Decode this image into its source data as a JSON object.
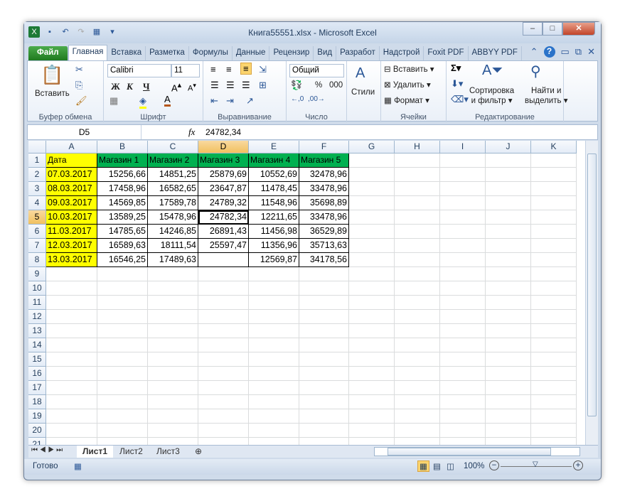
{
  "window": {
    "title": "Книга55551.xlsx - Microsoft Excel"
  },
  "tabs": [
    "Файл",
    "Главная",
    "Вставка",
    "Разметка",
    "Формулы",
    "Данные",
    "Рецензир",
    "Вид",
    "Разработ",
    "Надстрой",
    "Foxit PDF",
    "ABBYY PDF"
  ],
  "ribbon": {
    "clipboard": {
      "paste": "Вставить",
      "label": "Буфер обмена"
    },
    "font": {
      "name": "Calibri",
      "size": "11",
      "bold": "Ж",
      "italic": "К",
      "underline": "Ч",
      "label": "Шрифт"
    },
    "alignment": {
      "label": "Выравнивание"
    },
    "number": {
      "format": "Общий",
      "percent": "%",
      "thousands": "000",
      "label": "Число"
    },
    "styles": {
      "label": "Стили"
    },
    "cells": {
      "insert": "Вставить",
      "delete": "Удалить",
      "format": "Формат",
      "label": "Ячейки"
    },
    "editing": {
      "sort": "Сортировка",
      "sort2": "и фильтр",
      "find": "Найти и",
      "find2": "выделить",
      "label": "Редактирование"
    }
  },
  "formula_bar": {
    "name_box": "D5",
    "fx": "fx",
    "value": "24782,34"
  },
  "columns": [
    "A",
    "B",
    "C",
    "D",
    "E",
    "F",
    "G",
    "H",
    "I",
    "J",
    "K"
  ],
  "selected": {
    "col": "D",
    "row": 5
  },
  "rows": [
    [
      "Дата",
      "Магазин 1",
      "Магазин 2",
      "Магазин 3",
      "Магазин 4",
      "Магазин 5"
    ],
    [
      "07.03.2017",
      "15256,66",
      "14851,25",
      "25879,69",
      "10552,69",
      "32478,96"
    ],
    [
      "08.03.2017",
      "17458,96",
      "16582,65",
      "23647,87",
      "11478,45",
      "33478,96"
    ],
    [
      "09.03.2017",
      "14569,85",
      "17589,78",
      "24789,32",
      "11548,96",
      "35698,89"
    ],
    [
      "10.03.2017",
      "13589,25",
      "15478,96",
      "24782,34",
      "12211,65",
      "33478,96"
    ],
    [
      "11.03.2017",
      "14785,65",
      "14246,85",
      "26891,43",
      "11456,98",
      "36529,89"
    ],
    [
      "12.03.2017",
      "16589,63",
      "18111,54",
      "25597,47",
      "11356,96",
      "35713,63"
    ],
    [
      "13.03.2017",
      "16546,25",
      "17489,63",
      "",
      "12569,87",
      "34178,56"
    ]
  ],
  "row_count": 21,
  "colors": {
    "date_fill": "#ffff00",
    "header_fill": "#00b050"
  },
  "sheets": [
    "Лист1",
    "Лист2",
    "Лист3"
  ],
  "status": {
    "ready": "Готово",
    "zoom": "100%"
  }
}
